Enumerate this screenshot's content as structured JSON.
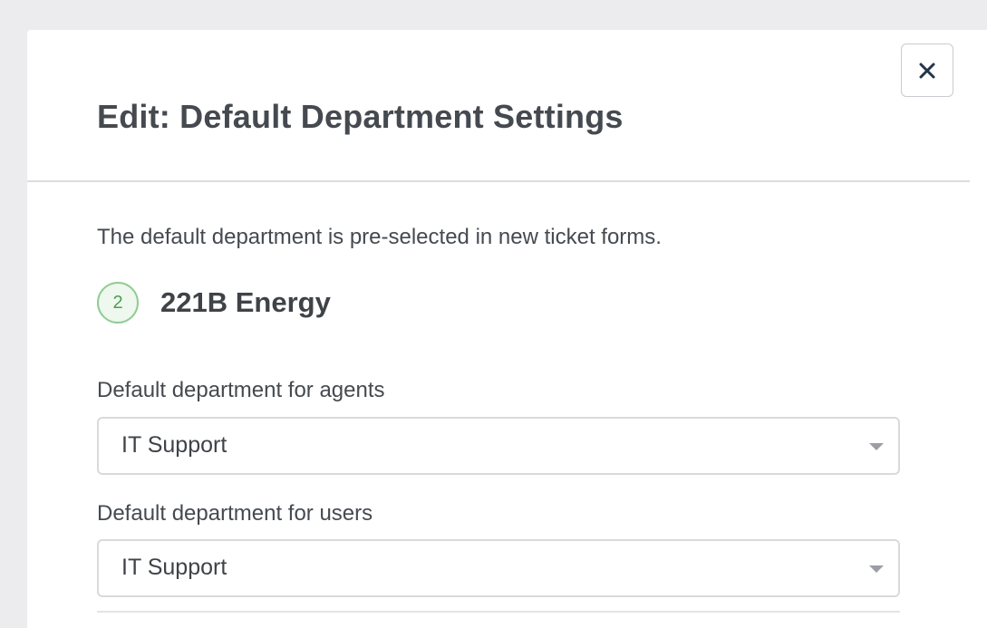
{
  "modal": {
    "title": "Edit: Default Department Settings",
    "close_icon": "close-icon",
    "description": "The default department is pre-selected in new ticket forms.",
    "organization": {
      "step_number": "2",
      "name": "221B Energy"
    },
    "fields": {
      "agents": {
        "label": "Default department for agents",
        "value": "IT Support",
        "icon": "chevron-down-icon"
      },
      "users": {
        "label": "Default department for users",
        "value": "IT Support",
        "icon": "chevron-down-icon"
      }
    }
  },
  "colors": {
    "background": "#ececee",
    "panel": "#ffffff",
    "text": "#454a50",
    "badge_border": "#8fcc93",
    "badge_text": "#4f9d55",
    "border": "#d8dadd"
  }
}
